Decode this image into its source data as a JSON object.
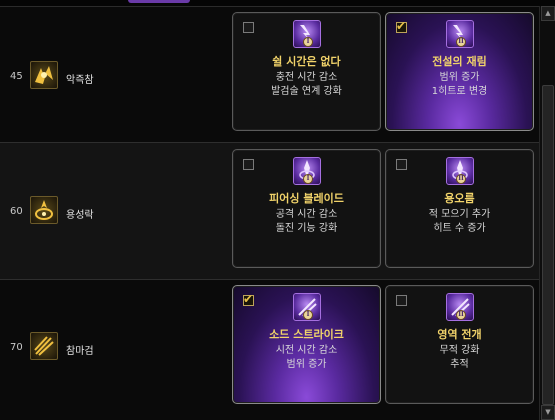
{
  "rows": [
    {
      "level": "45",
      "skill_name": "악즉참",
      "skill_icon": "demon-slash-icon",
      "options": [
        {
          "title": "쉴 시간은 없다",
          "lines": [
            "충전 시간 감소",
            "발검술 연계 강화"
          ],
          "checked": false,
          "tier": "I"
        },
        {
          "title": "전설의 재림",
          "lines": [
            "범위 증가",
            "1히트로 변경"
          ],
          "checked": true,
          "tier": "II"
        }
      ]
    },
    {
      "level": "60",
      "skill_name": "용성락",
      "skill_icon": "dragon-star-icon",
      "options": [
        {
          "title": "피어싱 블레이드",
          "lines": [
            "공격 시간 감소",
            "돌진 기능 강화"
          ],
          "checked": false,
          "tier": "I"
        },
        {
          "title": "용오름",
          "lines": [
            "적 모으기 추가",
            "히트 수 증가"
          ],
          "checked": false,
          "tier": "II"
        }
      ]
    },
    {
      "level": "70",
      "skill_name": "참마검",
      "skill_icon": "demon-blade-icon",
      "options": [
        {
          "title": "소드 스트라이크",
          "lines": [
            "시전 시간 감소",
            "범위 증가"
          ],
          "checked": true,
          "tier": "I"
        },
        {
          "title": "영역 전개",
          "lines": [
            "무적 강화",
            "추적"
          ],
          "checked": false,
          "tier": "II"
        }
      ]
    }
  ],
  "colors": {
    "title_gold": "#f1d36a",
    "selected_purple": "#5a2aa0",
    "check_gold": "#e8c04a"
  }
}
